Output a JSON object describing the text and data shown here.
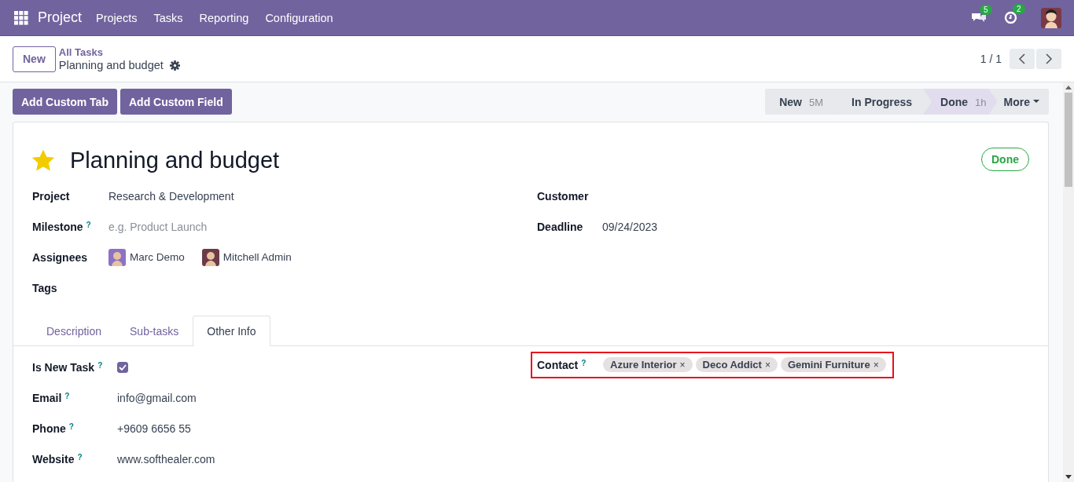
{
  "navbar": {
    "app": "Project",
    "menu": [
      "Projects",
      "Tasks",
      "Reporting",
      "Configuration"
    ],
    "messages_count": "5",
    "activities_count": "2"
  },
  "control_panel": {
    "new_button": "New",
    "breadcrumb": "All Tasks",
    "record": "Planning and budget",
    "pager": "1 / 1"
  },
  "action_buttons": [
    "Add Custom Tab",
    "Add Custom Field"
  ],
  "stages": [
    {
      "label": "New",
      "duration": "5M",
      "selected": false
    },
    {
      "label": "In Progress",
      "selected": false
    },
    {
      "label": "Done",
      "duration": "1h",
      "selected": true
    }
  ],
  "more_button": "More",
  "form": {
    "starred": true,
    "title": "Planning and budget",
    "status": "Done",
    "left_fields": [
      {
        "kind": "text",
        "label": "Project",
        "value": "Research & Development"
      },
      {
        "kind": "text",
        "label": "Milestone",
        "help": "?",
        "placeholder": "e.g. Product Launch"
      },
      {
        "kind": "people",
        "label": "Assignees",
        "people": [
          {
            "name": "Marc Demo"
          },
          {
            "name": "Mitchell Admin"
          }
        ]
      },
      {
        "kind": "text",
        "label": "Tags"
      }
    ],
    "right_fields": [
      {
        "label": "Customer"
      },
      {
        "label": "Deadline",
        "value": "09/24/2023"
      }
    ],
    "tabs": [
      {
        "label": "Description",
        "selected": false
      },
      {
        "label": "Sub-tasks",
        "selected": false
      },
      {
        "label": "Other Info",
        "selected": true
      }
    ],
    "tab_fields": [
      {
        "kind": "checkbox",
        "label": "Is New Task",
        "help": "?",
        "checked": true
      },
      {
        "kind": "text",
        "label": "Email",
        "help": "?",
        "value": "info@gmail.com"
      },
      {
        "kind": "text",
        "label": "Phone",
        "help": "?",
        "value": "+9609 6656 55"
      },
      {
        "kind": "text",
        "label": "Website",
        "help": "?",
        "value": "www.softhealer.com"
      }
    ],
    "contact": {
      "label": "Contact",
      "help": "?",
      "tags": [
        {
          "name": "Azure Interior",
          "remove": "×"
        },
        {
          "name": "Deco Addict",
          "remove": "×"
        },
        {
          "name": "Gemini Furniture",
          "remove": "×"
        }
      ]
    }
  }
}
